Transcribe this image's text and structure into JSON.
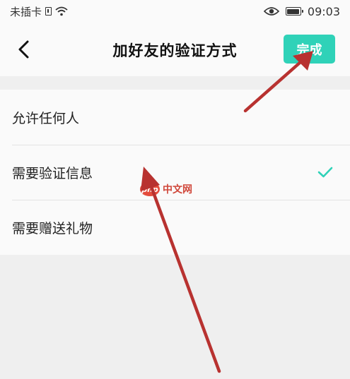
{
  "status_bar": {
    "carrier": "未插卡",
    "time": "09:03",
    "icons": [
      "sim-icon",
      "wifi-icon",
      "eye-icon",
      "battery-icon"
    ]
  },
  "nav": {
    "back_icon": "chevron-left-icon",
    "title": "加好友的验证方式",
    "done_label": "完成"
  },
  "options": [
    {
      "label": "允许任何人",
      "selected": false
    },
    {
      "label": "需要验证信息",
      "selected": true
    },
    {
      "label": "需要赠送礼物",
      "selected": false
    }
  ],
  "watermark": {
    "logo": "php",
    "text": "中文网"
  },
  "colors": {
    "accent": "#2fd2b8",
    "arrow": "#b83230",
    "background": "#efefef"
  }
}
